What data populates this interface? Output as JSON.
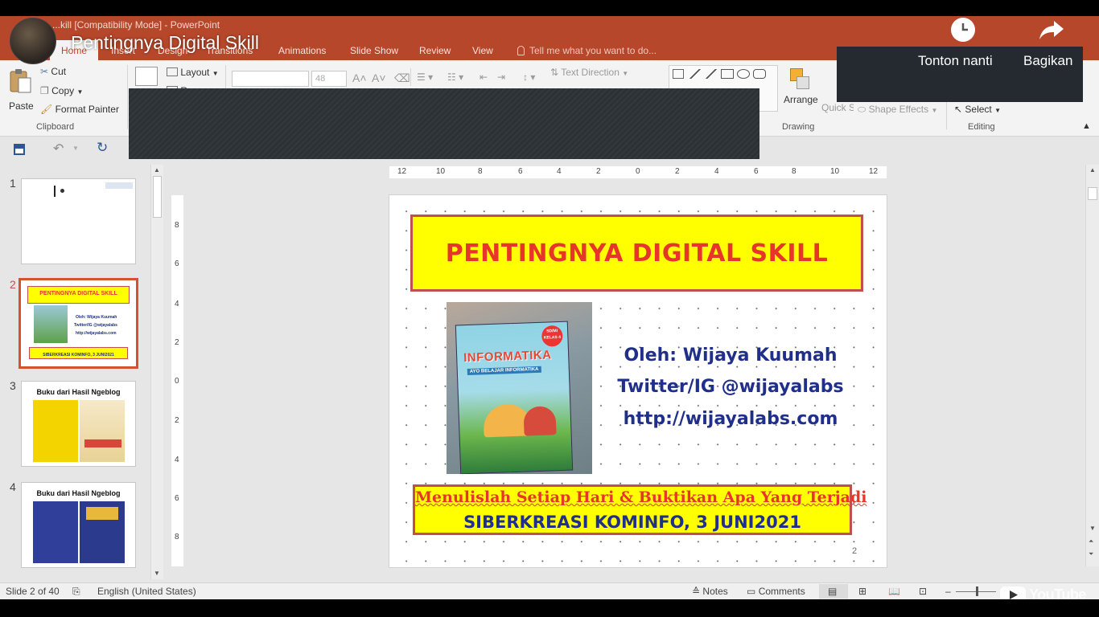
{
  "window": {
    "title": "...kill [Compatibility Mode] - PowerPoint"
  },
  "video": {
    "title": "Pentingnya Digital Skill",
    "watch_later": "Tonton nanti",
    "share": "Bagikan",
    "brand": "YouTube"
  },
  "tabs": [
    {
      "label": "Home",
      "active": true
    },
    {
      "label": "Insert"
    },
    {
      "label": "Design"
    },
    {
      "label": "Transitions"
    },
    {
      "label": "Animations"
    },
    {
      "label": "Slide Show"
    },
    {
      "label": "Review"
    },
    {
      "label": "View"
    }
  ],
  "tell_me": "Tell me what you want to do...",
  "ribbon": {
    "clipboard": {
      "paste": "Paste",
      "cut": "Cut",
      "copy": "Copy",
      "format_painter": "Format Painter",
      "group": "Clipboard"
    },
    "slides": {
      "layout": "Layout",
      "new_slide_partial": "R"
    },
    "font": {
      "size": "48"
    },
    "paragraph": {
      "text_direction": "Text Direction"
    },
    "drawing": {
      "arrange": "Arrange",
      "quick_styles": "Quick Styles",
      "shape_effects": "Shape Effects",
      "group": "Drawing"
    },
    "editing": {
      "select": "Select",
      "group": "Editing"
    }
  },
  "thumbnails": [
    {
      "number": "1",
      "selected": false
    },
    {
      "number": "2",
      "selected": true,
      "title": "PENTINGNYA DIGITAL SKILL",
      "lines": [
        "Oleh: Wijaya Kuumah",
        "Twitter/IG @wijayalabs",
        "http://wijayalabs.com"
      ],
      "footer": "SIBERKREASI KOMINFO, 3 JUNI2021"
    },
    {
      "number": "3",
      "selected": false,
      "title": "Buku dari Hasil Ngeblog"
    },
    {
      "number": "4",
      "selected": false,
      "title": "Buku dari Hasil Ngeblog"
    }
  ],
  "ruler": {
    "horizontal": [
      "12",
      "10",
      "8",
      "6",
      "4",
      "2",
      "0",
      "2",
      "4",
      "6",
      "8",
      "10",
      "12"
    ],
    "vertical": [
      "8",
      "6",
      "4",
      "2",
      "0",
      "2",
      "4",
      "6",
      "8"
    ]
  },
  "slide": {
    "title": "PENTINGNYA DIGITAL SKILL",
    "author": "Oleh: Wijaya Kuumah",
    "social": "Twitter/IG @wijayalabs",
    "url": "http://wijayalabs.com",
    "tagline": "Menulislah Setiap Hari & Buktikan Apa Yang Terjadi",
    "event": "SIBERKREASI KOMINFO, 3 JUNI2021",
    "number": "2",
    "book_cover": {
      "badge": "SD/MI KELAS 4",
      "title": "INFORMATIKA",
      "subtitle": "AYO BELAJAR INFORMATIKA"
    }
  },
  "status": {
    "slide_position": "Slide 2 of 40",
    "language": "English (United States)",
    "notes": "Notes",
    "comments": "Comments"
  },
  "colors": {
    "ribbon_accent": "#b7472a",
    "slide_title_fill": "#ffff00",
    "slide_title_text": "#e8352b",
    "slide_body_text": "#1f2f8a"
  }
}
